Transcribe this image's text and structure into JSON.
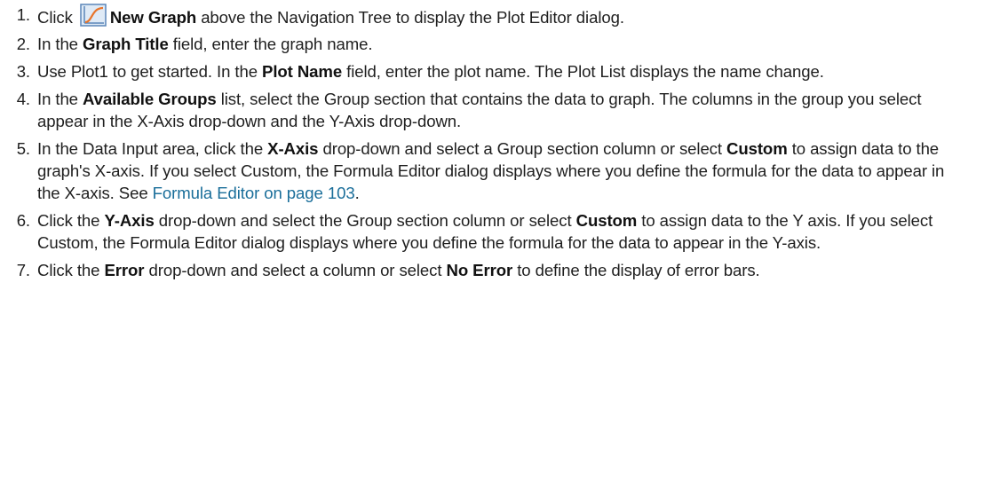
{
  "steps": [
    {
      "num": "1.",
      "before": "Click ",
      "icon": "new-graph-icon",
      "bold": "New Graph",
      "after": " above the Navigation Tree to display the Plot Editor dialog."
    },
    {
      "num": "2.",
      "before": "In the ",
      "bold": "Graph Title",
      "after": " field, enter the graph name."
    },
    {
      "num": "3.",
      "before": "Use Plot1 to get started. In the ",
      "bold": "Plot Name",
      "after": " field, enter the plot name. The Plot List displays the name change."
    },
    {
      "num": "4.",
      "before": "In the ",
      "bold": "Available Groups",
      "after": " list, select the Group section that contains the data to graph. The columns in the group you select appear in the X-Axis drop-down and the Y-Axis drop-down."
    },
    {
      "num": "5.",
      "before": "In the Data Input area, click the ",
      "bold": "X-Axis",
      "mid": " drop-down and select a Group section column or select ",
      "bold2": "Custom",
      "after": " to assign data to the graph's X-axis. If you select Custom, the Formula Editor dialog displays where you define the formula for the data to appear in the X-axis. See ",
      "link": "Formula Editor on page 103",
      "end": "."
    },
    {
      "num": "6.",
      "before": "Click the ",
      "bold": "Y-Axis",
      "mid": " drop-down and select the Group section column or select ",
      "bold2": "Custom",
      "after": " to assign data to the Y axis. If you select Custom, the Formula Editor dialog displays where you define the formula for the data to appear in the Y-axis."
    },
    {
      "num": "7.",
      "before": "Click the ",
      "bold": "Error",
      "mid": " drop-down and select a column or select ",
      "bold2": "No Error",
      "after": " to define the display of error bars."
    }
  ],
  "colors": {
    "text": "#1f1f1f",
    "link": "#1a6e9a",
    "icon_frame": "#5b86b8",
    "icon_curve": "#e8742a"
  }
}
